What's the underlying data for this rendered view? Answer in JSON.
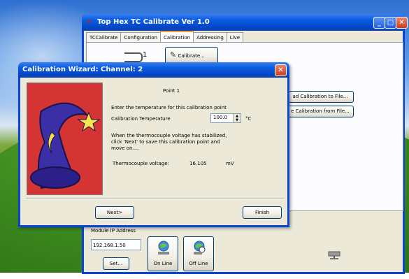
{
  "main_window": {
    "title": "Top Hex TC Calibrate Ver 1.0",
    "tabs": [
      "TCCalibrate",
      "Configuration",
      "Calibration",
      "Addressing",
      "Live"
    ],
    "active_tab": "Calibration",
    "channel_number": "1",
    "calibrate_button": "Calibrate...",
    "save_calibration_button": "ad Calibration to File...",
    "load_calibration_button": "e Calibration from File...",
    "module_ip": {
      "label": "Module IP Address",
      "value": "192.168.1.50",
      "set_button": "Set...",
      "online_button": "On Line",
      "offline_button": "Off Line"
    }
  },
  "dialog": {
    "title": "Calibration Wizard: Channel: 2",
    "heading": "Point 1",
    "instruction": "Enter the temperature for this calibration point",
    "temp_label": "Calibration Temperature",
    "temp_value": "100.0",
    "temp_unit": "°C",
    "stabilize_text_1": "When the thermocouple voltage has stabilized,",
    "stabilize_text_2": "click 'Next' to save this calibration point and",
    "stabilize_text_3": "move on....",
    "voltage_label": "Thermocouple voltage:",
    "voltage_value": "16.105",
    "voltage_unit": "mV",
    "next_button": "Next>",
    "finish_button": "Finish"
  },
  "colors": {
    "title_bar_blue": "#0a5ce0",
    "close_red": "#d9532f",
    "wizard_bg_red": "#d43434",
    "hat_blue": "#2b3b9a"
  },
  "icons": [
    "wizard-hat-icon",
    "network-online-icon",
    "network-offline-icon",
    "thermocouple-icon",
    "calibrate-icon",
    "network-status-icon"
  ]
}
